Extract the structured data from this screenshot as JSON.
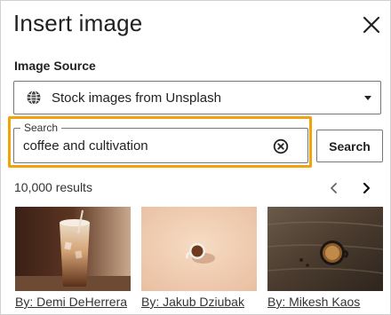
{
  "dialog": {
    "title": "Insert image",
    "close_icon": "close-icon"
  },
  "source": {
    "label": "Image Source",
    "selected": "Stock images from Unsplash",
    "icon": "globe-icon"
  },
  "search": {
    "legend": "Search",
    "value": "coffee and cultivation",
    "clear_icon": "clear-circle-icon",
    "button_label": "Search",
    "highlight_color": "#f0a30a"
  },
  "results": {
    "count": "10,000 results",
    "prev_icon": "chevron-left-icon",
    "next_icon": "chevron-right-icon",
    "items": [
      {
        "credit": "By: Demi DeHerrera",
        "subject": "iced coffee drink"
      },
      {
        "credit": "By: Jakub Dziubak",
        "subject": "coffee cup on beige"
      },
      {
        "credit": "By: Mikesh Kaos",
        "subject": "coffee cup on wooden table"
      }
    ]
  }
}
